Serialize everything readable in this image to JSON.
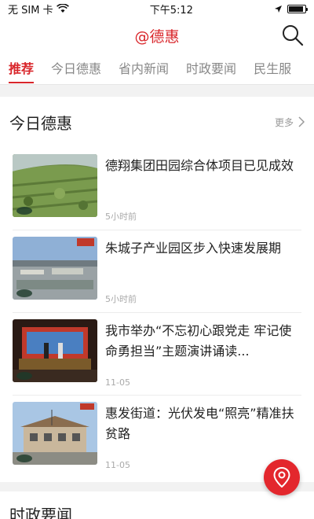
{
  "status_bar": {
    "carrier": "无 SIM 卡",
    "time": "下午5:12"
  },
  "nav": {
    "title": "@德惠"
  },
  "tabs": [
    {
      "label": "推荐",
      "active": true
    },
    {
      "label": "今日德惠",
      "active": false
    },
    {
      "label": "省内新闻",
      "active": false
    },
    {
      "label": "时政要闻",
      "active": false
    },
    {
      "label": "民生服",
      "active": false
    }
  ],
  "section": {
    "title": "今日德惠",
    "more_label": "更多",
    "items": [
      {
        "title": "德翔集团田园综合体项目已见成效",
        "time": "5小时前"
      },
      {
        "title": "朱城子产业园区步入快速发展期",
        "time": "5小时前"
      },
      {
        "title": "我市举办“不忘初心跟党走 牢记使命勇担当”主题演讲诵读...",
        "time": "11-05"
      },
      {
        "title": "惠发街道：光伏发电“照亮”精准扶贫路",
        "time": "11-05"
      }
    ]
  },
  "section2": {
    "title": "时政要闻"
  },
  "colors": {
    "accent": "#d9262b"
  }
}
